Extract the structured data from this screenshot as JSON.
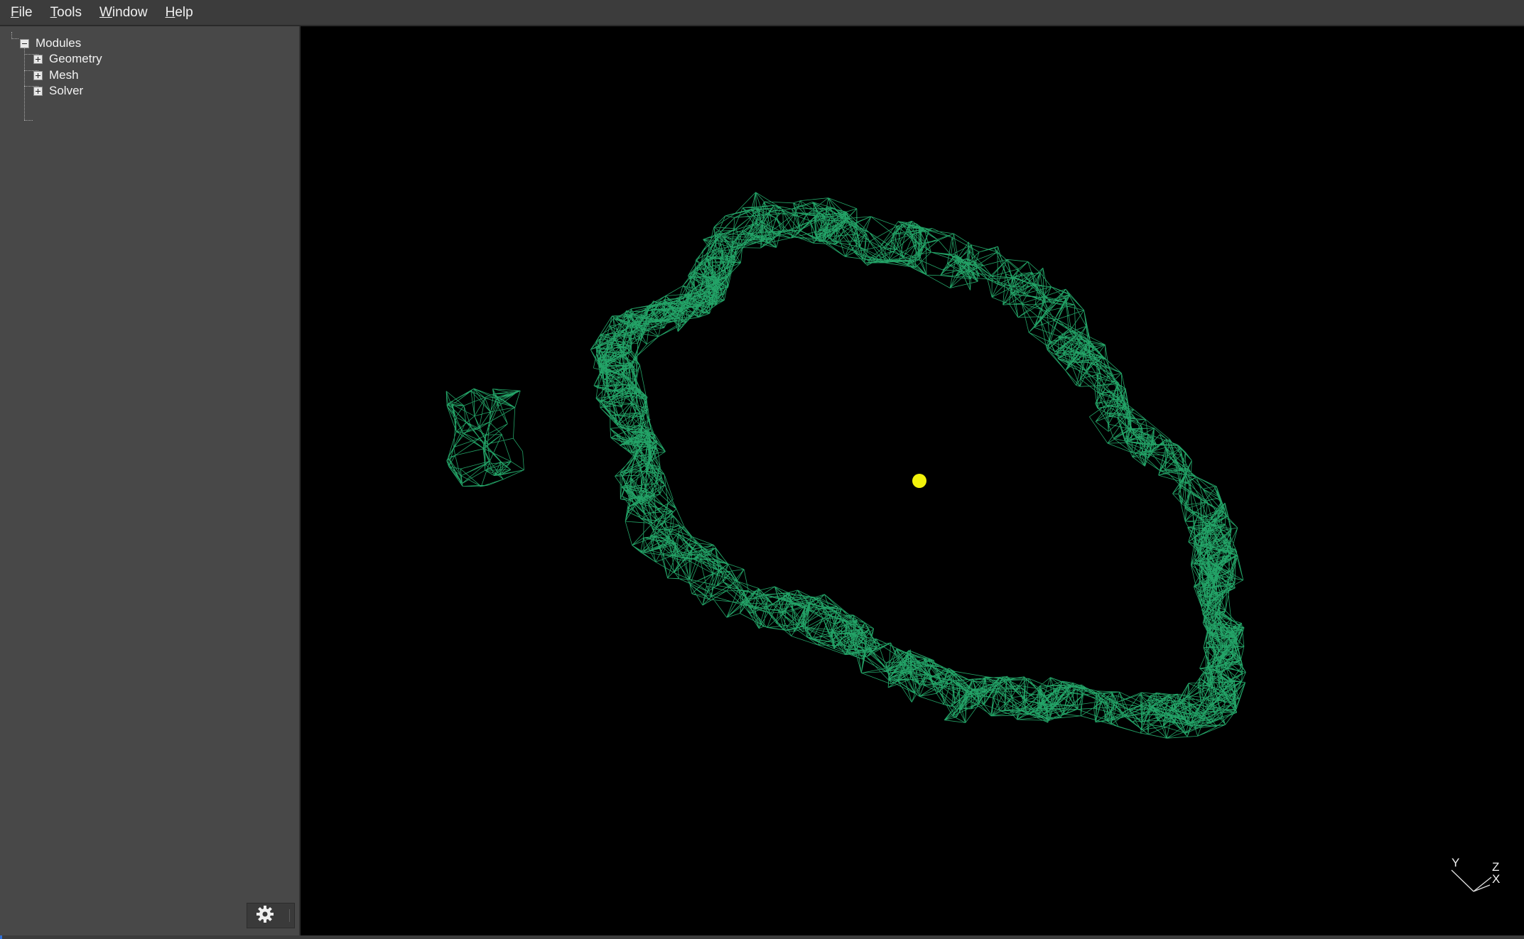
{
  "menubar": {
    "items": [
      {
        "mnemonic": "F",
        "rest": "ile"
      },
      {
        "mnemonic": "T",
        "rest": "ools"
      },
      {
        "mnemonic": "W",
        "rest": "indow"
      },
      {
        "mnemonic": "H",
        "rest": "elp"
      }
    ]
  },
  "tree": {
    "root": {
      "label": "Modules",
      "expanded": true
    },
    "children": [
      {
        "label": "Geometry",
        "expanded": false
      },
      {
        "label": "Mesh",
        "expanded": false
      },
      {
        "label": "Solver",
        "expanded": false
      }
    ]
  },
  "viewport": {
    "background": "#000000",
    "mesh_color": "#2fd98a",
    "marker_color": "#f2f20a",
    "axes": {
      "y_label": "Y",
      "z_label": "Z",
      "x_label": "X"
    }
  },
  "settings": {
    "icon": "gear-icon"
  }
}
